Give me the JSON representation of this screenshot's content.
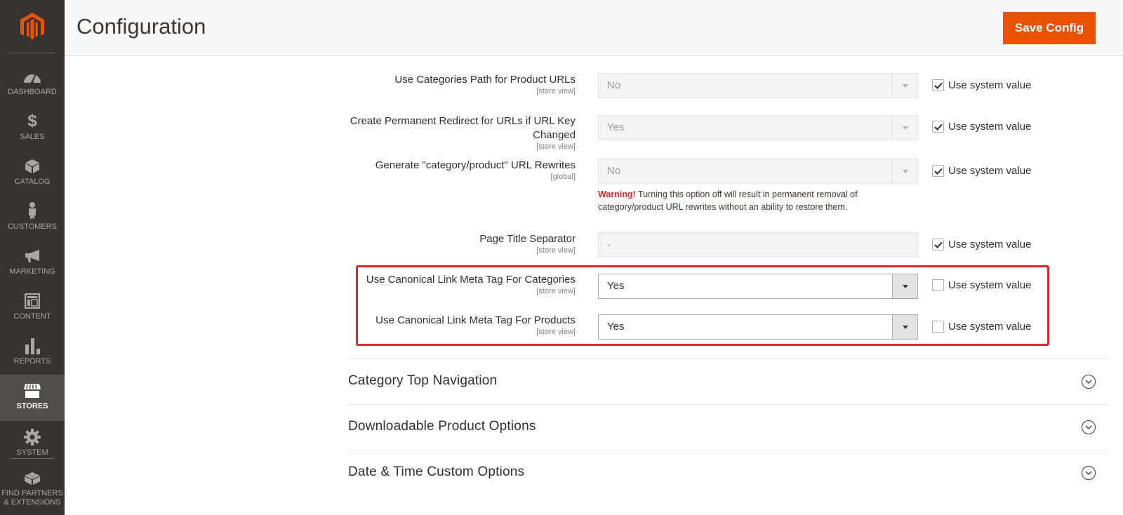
{
  "sidebar": {
    "logo": "magento-logo",
    "items": [
      {
        "label": "DASHBOARD",
        "icon": "dashboard-icon",
        "active": false
      },
      {
        "label": "SALES",
        "icon": "dollar-icon",
        "active": false
      },
      {
        "label": "CATALOG",
        "icon": "box-icon",
        "active": false
      },
      {
        "label": "CUSTOMERS",
        "icon": "person-icon",
        "active": false
      },
      {
        "label": "MARKETING",
        "icon": "megaphone-icon",
        "active": false
      },
      {
        "label": "CONTENT",
        "icon": "layout-icon",
        "active": false
      },
      {
        "label": "REPORTS",
        "icon": "bar-chart-icon",
        "active": false
      },
      {
        "label": "STORES",
        "icon": "storefront-icon",
        "active": true
      },
      {
        "label": "SYSTEM",
        "icon": "gear-icon",
        "active": false
      },
      {
        "label": "FIND PARTNERS & EXTENSIONS",
        "icon": "blocks-icon",
        "active": false
      }
    ]
  },
  "header": {
    "title": "Configuration",
    "save_label": "Save Config"
  },
  "fields": [
    {
      "label": "Use Categories Path for Product URLs",
      "scope": "[store view]",
      "value": "No",
      "type": "select",
      "disabled": true,
      "use_system_value": true
    },
    {
      "label": "Create Permanent Redirect for URLs if URL Key Changed",
      "scope": "[store view]",
      "value": "Yes",
      "type": "select",
      "disabled": true,
      "use_system_value": true
    },
    {
      "label": "Generate \"category/product\" URL Rewrites",
      "scope": "[global]",
      "value": "No",
      "type": "select",
      "disabled": true,
      "use_system_value": true
    },
    {
      "label": "Page Title Separator",
      "scope": "[store view]",
      "value": "-",
      "type": "text",
      "disabled": true,
      "use_system_value": true
    },
    {
      "label": "Use Canonical Link Meta Tag For Categories",
      "scope": "[store view]",
      "value": "Yes",
      "type": "select",
      "disabled": false,
      "use_system_value": false
    },
    {
      "label": "Use Canonical Link Meta Tag For Products",
      "scope": "[store view]",
      "value": "Yes",
      "type": "select",
      "disabled": false,
      "use_system_value": false
    }
  ],
  "use_system_value_label": "Use system value",
  "warning": {
    "strong": "Warning!",
    "text": " Turning this option off will result in permanent removal of category/product URL rewrites without an ability to restore them."
  },
  "sections": [
    {
      "title": "Category Top Navigation"
    },
    {
      "title": "Downloadable Product Options"
    },
    {
      "title": "Date & Time Custom Options"
    }
  ],
  "colors": {
    "accent": "#eb5202",
    "highlight_border": "#e0272c",
    "sidebar_bg": "#373330",
    "warning": "#e22626"
  }
}
